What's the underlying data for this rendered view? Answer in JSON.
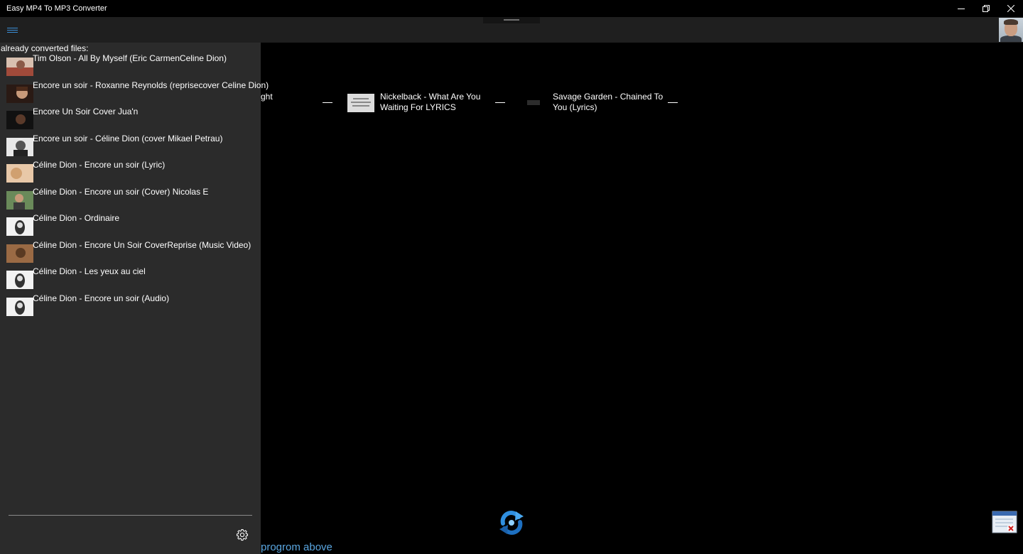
{
  "window": {
    "title": "Easy MP4 To MP3 Converter",
    "controls": [
      "minimize-icon",
      "restore-icon",
      "close-icon"
    ]
  },
  "appbar": {
    "menu_icon": "hamburger-menu-icon",
    "accent_color": "#3b8fd9",
    "avatar": "user-avatar"
  },
  "sidebar": {
    "header": "already converted files:",
    "items": [
      {
        "title": "Tim Olson - All By Myself (Eric CarmenCeline Dion)",
        "thumb_color": "#b87060"
      },
      {
        "title": "Encore un soir - Roxanne Reynolds (reprisecover Celine Dion)",
        "thumb_color": "#6a4a3a"
      },
      {
        "title": "Encore Un Soir Cover Jua'n",
        "thumb_color": "#3a2a22"
      },
      {
        "title": "Encore un soir - Céline Dion (cover Mikael Petrau)",
        "thumb_color": "#8a8a8a"
      },
      {
        "title": "Céline Dion - Encore un soir (Lyric)",
        "thumb_color": "#d8b090"
      },
      {
        "title": "Céline Dion - Encore un soir (Cover) Nicolas E",
        "thumb_color": "#5a7a4a"
      },
      {
        "title": "Céline Dion - Ordinaire",
        "thumb_color": "#e0e0e0"
      },
      {
        "title": "Céline Dion - Encore Un Soir CoverReprise (Music Video)",
        "thumb_color": "#8a5a3a"
      },
      {
        "title": "Céline Dion - Les yeux au ciel",
        "thumb_color": "#e0e0e0"
      },
      {
        "title": "Céline Dion - Encore un soir (Audio)",
        "thumb_color": "#e0e0e0"
      }
    ],
    "settings_icon": "gear-icon"
  },
  "queue": {
    "items": [
      {
        "title_line1": "ght",
        "title_line2": ""
      },
      {
        "title_line1": "Nickelback - What Are You",
        "title_line2": "Waiting For LYRICS"
      },
      {
        "title_line1": "Savage Garden - Chained To",
        "title_line2": "You (Lyrics)"
      }
    ]
  },
  "main": {
    "convert_icon": "refresh-convert-icon",
    "prompt": "progrom above",
    "prompt_color": "#5aa6e0",
    "corner_icon": "window-close-widget-icon"
  }
}
